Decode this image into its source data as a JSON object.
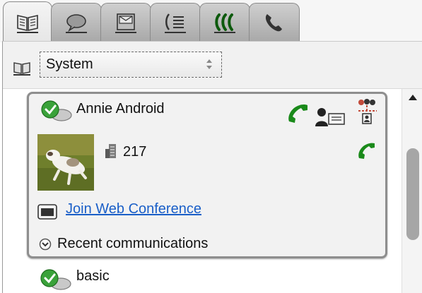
{
  "tabs": [
    {
      "name": "tab-directory",
      "icon": "directory-book-icon",
      "active": true
    },
    {
      "name": "tab-chat",
      "icon": "chat-bubble-icon",
      "active": false
    },
    {
      "name": "tab-messages",
      "icon": "inbox-icon",
      "active": false
    },
    {
      "name": "tab-call-log",
      "icon": "call-log-icon",
      "active": false
    },
    {
      "name": "tab-conference",
      "icon": "conference-icon",
      "active": false
    },
    {
      "name": "tab-phone",
      "icon": "phone-icon",
      "active": false
    }
  ],
  "source": {
    "selected": "System",
    "icon": "directory-book-icon"
  },
  "contact": {
    "name": "Annie Android",
    "presence": "available",
    "extension": "217",
    "conference_link": "Join Web Conference",
    "recent_label": "Recent communications"
  },
  "contacts": [
    {
      "name": "basic",
      "presence": "available"
    }
  ],
  "colors": {
    "call_green": "#1a8a1a",
    "link": "#1a5fc8",
    "presence_green": "#3aa23a"
  }
}
